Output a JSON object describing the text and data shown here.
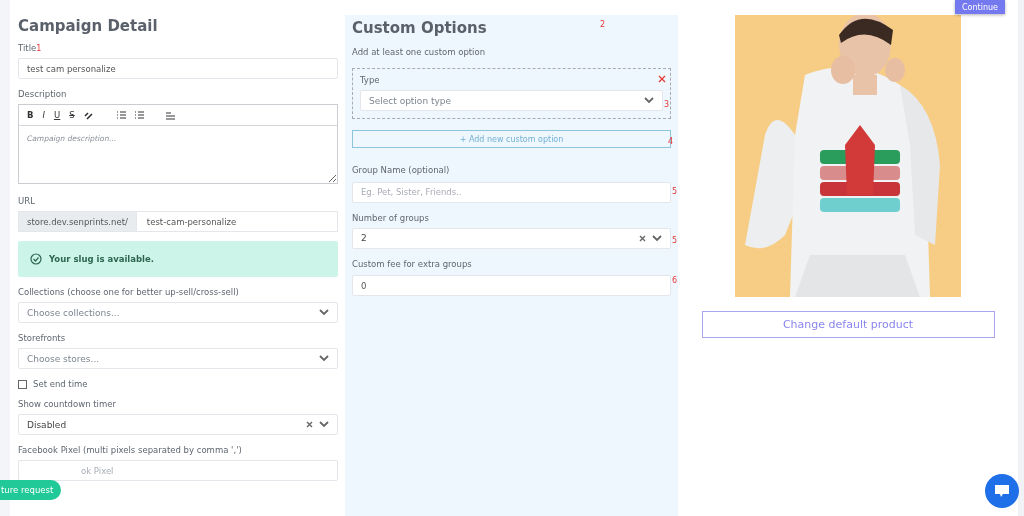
{
  "top_button": "Continue",
  "campaign_detail": {
    "heading": "Campaign Detail",
    "title": {
      "label": "Title",
      "marker": "1",
      "value": "test cam personalize"
    },
    "description": {
      "label": "Description",
      "placeholder": "Campaign description...",
      "toolbar": [
        "B",
        "I",
        "U",
        "S"
      ]
    },
    "url": {
      "label": "URL",
      "prefix": "store.dev.senprints.net/",
      "value": "test-cam-personalize"
    },
    "slug_alert": "Your slug is available.",
    "collections": {
      "label": "Collections (choose one for better up-sell/cross-sell)",
      "placeholder": "Choose collections..."
    },
    "storefronts": {
      "label": "Storefronts",
      "placeholder": "Choose stores..."
    },
    "set_end_time": {
      "label": "Set end time",
      "checked": false
    },
    "countdown": {
      "label": "Show countdown timer",
      "value": "Disabled"
    },
    "facebook_pixel": {
      "label": "Facebook Pixel (multi pixels separated by comma ',')",
      "placeholder": "ok Pixel"
    }
  },
  "custom_options": {
    "heading": "Custom Options",
    "marker": "2",
    "hint": "Add at least one custom option",
    "option": {
      "label": "Type",
      "placeholder": "Select option type",
      "marker": "3"
    },
    "add_button": "+ Add new custom option",
    "add_marker": "4",
    "group_name": {
      "label": "Group Name (optional)",
      "placeholder": "Eg. Pet, Sister, Friends..",
      "marker": "5"
    },
    "number_of_groups": {
      "label": "Number of groups",
      "value": "2",
      "marker": "5"
    },
    "custom_fee": {
      "label": "Custom fee for extra groups",
      "value": "0",
      "marker": "6"
    }
  },
  "product": {
    "change_button": "Change default product"
  },
  "feature_request": "ture request"
}
